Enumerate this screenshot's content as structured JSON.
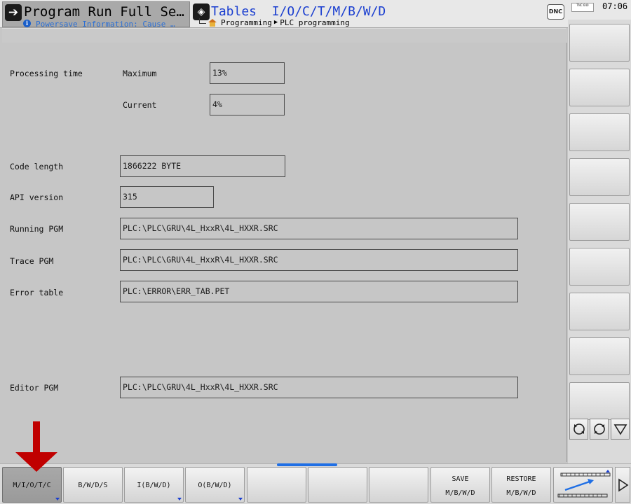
{
  "header": {
    "mode_left_title": "Program Run Full Se…",
    "mode_left_info": "Powersave Information: Cause …",
    "mode_right_title": "Tables  I/O/C/T/M/B/W/D",
    "breadcrumb": [
      "Programming",
      "PLC programming"
    ],
    "dnc_label": "DNC",
    "tnc_label": "TNC 640",
    "clock": "07:06"
  },
  "form": {
    "processing_time_label": "Processing time",
    "maximum_label": "Maximum",
    "maximum_value": "13%",
    "current_label": "Current",
    "current_value": "4%",
    "code_length_label": "Code length",
    "code_length_value": "1866222 BYTE",
    "api_version_label": "API version",
    "api_version_value": "315",
    "running_pgm_label": "Running PGM",
    "running_pgm_value": "PLC:\\PLC\\GRU\\4L_HxxR\\4L_HXXR.SRC",
    "trace_pgm_label": "Trace PGM",
    "trace_pgm_value": "PLC:\\PLC\\GRU\\4L_HxxR\\4L_HXXR.SRC",
    "error_table_label": "Error table",
    "error_table_value": "PLC:\\ERROR\\ERR_TAB.PET",
    "editor_pgm_label": "Editor PGM",
    "editor_pgm_value": "PLC:\\PLC\\GRU\\4L_HxxR\\4L_HXXR.SRC"
  },
  "softkeys": {
    "k1": "M/I/O/T/C",
    "k2": "B/W/D/S",
    "k3": "I(B/W/D)",
    "k4": "O(B/W/D)",
    "save_l1": "SAVE",
    "save_l2": "M/B/W/D",
    "restore_l1": "RESTORE",
    "restore_l2": "M/B/W/D"
  },
  "colors": {
    "accent_blue": "#1b3fd0",
    "info_blue": "#2a6fd6",
    "arrow_red": "#c00000",
    "progress_blue": "#1f6fe5"
  }
}
